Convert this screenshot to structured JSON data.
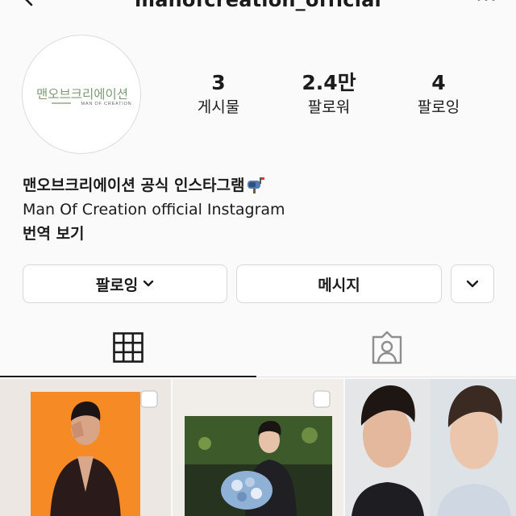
{
  "header": {
    "username": "manofcreation_official"
  },
  "avatar": {
    "logo_korean": "맨오브크리에이션",
    "logo_english": "MAN OF CREATION"
  },
  "stats": [
    {
      "value": "3",
      "label": "게시물"
    },
    {
      "value": "2.4만",
      "label": "팔로워"
    },
    {
      "value": "4",
      "label": "팔로잉"
    }
  ],
  "bio": {
    "name": "맨오브크리에이션 공식 인스타그램",
    "description": "Man Of Creation official Instagram",
    "translate_label": "번역 보기"
  },
  "actions": {
    "follow_label": "팔로잉",
    "message_label": "메시지"
  },
  "icons": {
    "back": "chevron-left-icon",
    "more": "more-horizontal-icon",
    "mailbox": "mailbox-icon",
    "grid": "grid-icon",
    "tagged": "tagged-person-icon",
    "multi_post": "multiple-posts-icon"
  },
  "colors": {
    "logo_green": "#7d9b72",
    "tile1_bg": "#f2821a"
  }
}
